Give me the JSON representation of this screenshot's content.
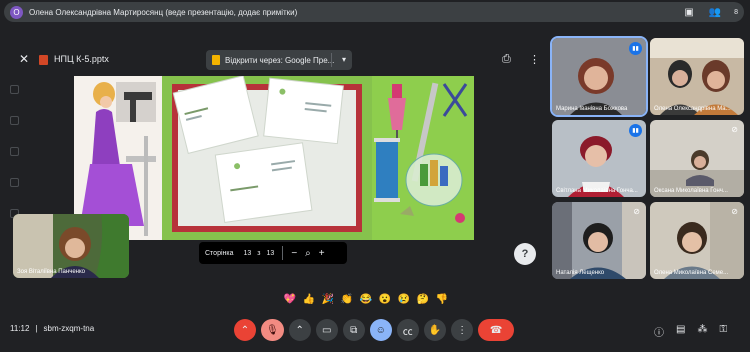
{
  "presenter_bar": {
    "avatar_letter": "О",
    "title": "Олена Олександрівна Мартиросянц (веде презентацію, додає примітки)",
    "participant_count": "8"
  },
  "viewer": {
    "file_name": "НПЦ К-5.pptx",
    "open_with": "Відкрити через: Google Пре...",
    "page_label": "Сторінка",
    "page_current": "13",
    "page_of": "з",
    "page_total": "13"
  },
  "self_tile": {
    "name": "Зоя Віталіївна Панченко"
  },
  "participants": [
    {
      "name": "Марина Іванівна Божкова",
      "speaking": true
    },
    {
      "name": "Олена Олександрівна Ма...",
      "speaking": false
    },
    {
      "name": "Світлана Миколаївна Гонча...",
      "speaking": true
    },
    {
      "name": "Оксана Миколаївна Гонч...",
      "speaking": false
    },
    {
      "name": "Наталія Лещенко",
      "speaking": false
    },
    {
      "name": "Олена Миколаївна Семе...",
      "speaking": false
    }
  ],
  "reactions": [
    "💖",
    "👍",
    "🎉",
    "👏",
    "😂",
    "😮",
    "😢",
    "🤔",
    "👎"
  ],
  "meeting": {
    "time": "11:12",
    "separator": "|",
    "code": "sbm-zxqm-tna"
  },
  "colors": {
    "accent": "#8ab4f8",
    "leave": "#ea4335",
    "mic_off": "#f28b82"
  }
}
